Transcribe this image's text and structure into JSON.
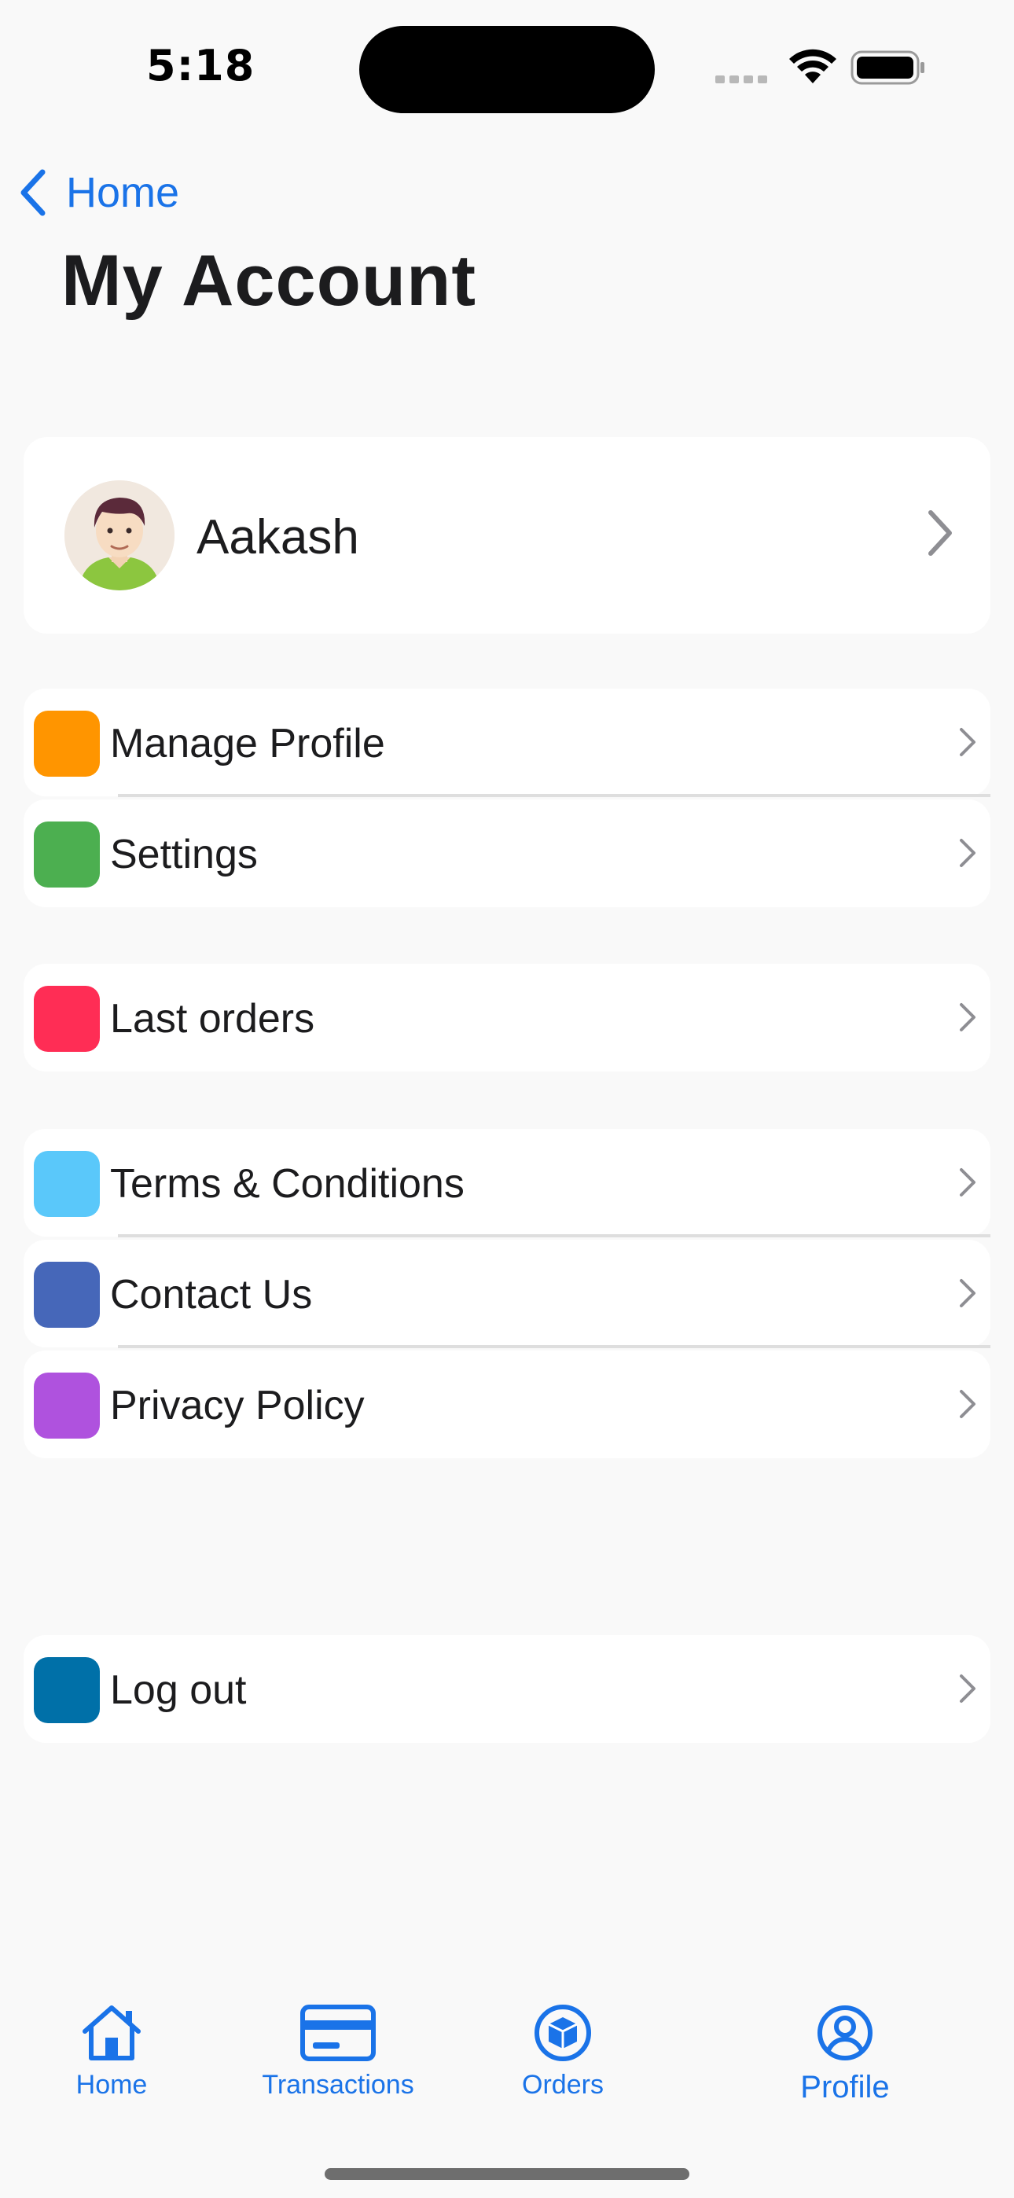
{
  "status": {
    "time": "5:18"
  },
  "nav": {
    "back_label": "Home",
    "title": "My Account"
  },
  "profile": {
    "name": "Aakash"
  },
  "groups": [
    [
      {
        "label": "Manage Profile",
        "color": "#ff9500"
      },
      {
        "label": "Settings",
        "color": "#4caf50"
      }
    ],
    [
      {
        "label": "Last orders",
        "color": "#ff2d55"
      }
    ],
    [
      {
        "label": "Terms & Conditions",
        "color": "#5ac8fa"
      },
      {
        "label": "Contact Us",
        "color": "#4667b9"
      },
      {
        "label": "Privacy Policy",
        "color": "#af52de"
      }
    ],
    [
      {
        "label": "Log out",
        "color": "#0070a8"
      }
    ]
  ],
  "tabs": [
    {
      "label": "Home",
      "icon": "house-icon"
    },
    {
      "label": "Transactions",
      "icon": "card-icon"
    },
    {
      "label": "Orders",
      "icon": "box-icon"
    },
    {
      "label": "Profile",
      "icon": "person-circle-icon"
    }
  ],
  "colors": {
    "accent": "#1a73e8",
    "background": "#f9f9f9",
    "card": "#ffffff"
  }
}
